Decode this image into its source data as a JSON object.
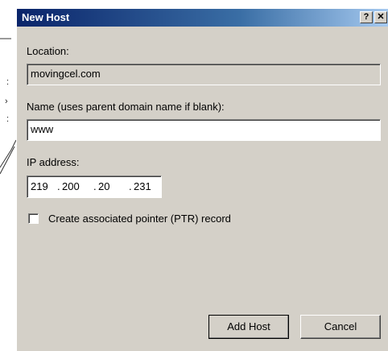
{
  "window": {
    "title": "New Host",
    "help_label": "?",
    "close_label": "✕"
  },
  "location": {
    "label": "Location:",
    "value": "movingcel.com"
  },
  "name": {
    "label": "Name (uses parent domain name if blank):",
    "value": "www"
  },
  "ip": {
    "label": "IP address:",
    "octets": [
      "219",
      "200",
      "20",
      "231"
    ],
    "dot": "."
  },
  "ptr": {
    "label": "Create associated pointer (PTR) record",
    "checked": false
  },
  "buttons": {
    "add_host": "Add Host",
    "cancel": "Cancel"
  },
  "background": {
    "marks": [
      ":",
      "›",
      ":"
    ]
  },
  "colors": {
    "dialog_face": "#d4d0c8",
    "title_start": "#0a246a",
    "title_end": "#a6caf0"
  }
}
